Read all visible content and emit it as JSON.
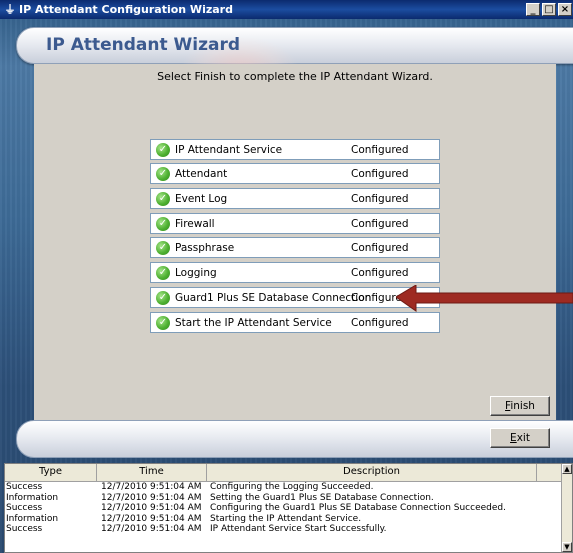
{
  "window": {
    "title": "IP Attendant Configuration Wizard",
    "minimize": "_",
    "maximize": "□",
    "close": "×"
  },
  "header": {
    "title": "IP Attendant Wizard"
  },
  "instruction": "Select Finish to complete the IP Attendant Wizard.",
  "steps": [
    {
      "name": "IP Attendant Service",
      "status": "Configured"
    },
    {
      "name": "Attendant",
      "status": "Configured"
    },
    {
      "name": "Event Log",
      "status": "Configured"
    },
    {
      "name": "Firewall",
      "status": "Configured"
    },
    {
      "name": "Passphrase",
      "status": "Configured"
    },
    {
      "name": "Logging",
      "status": "Configured"
    },
    {
      "name": "Guard1 Plus SE Database Connection",
      "status": "Configured"
    },
    {
      "name": "Start the IP Attendant Service",
      "status": "Configured"
    }
  ],
  "buttons": {
    "finish_first": "F",
    "finish_rest": "inish",
    "exit_first": "E",
    "exit_rest": "xit"
  },
  "log": {
    "columns": [
      "Type",
      "Time",
      "Description"
    ],
    "rows": [
      {
        "type": "Success",
        "time": "12/7/2010 9:51:04 AM",
        "description": "Configuring the Logging Succeeded."
      },
      {
        "type": "Information",
        "time": "12/7/2010 9:51:04 AM",
        "description": "Setting the Guard1 Plus SE Database Connection."
      },
      {
        "type": "Success",
        "time": "12/7/2010 9:51:04 AM",
        "description": "Configuring the Guard1 Plus SE Database Connection Succeeded."
      },
      {
        "type": "Information",
        "time": "12/7/2010 9:51:04 AM",
        "description": "Starting the IP Attendant Service."
      },
      {
        "type": "Success",
        "time": "12/7/2010 9:51:04 AM",
        "description": "IP Attendant Service Start Successfully."
      }
    ]
  },
  "colors": {
    "accent_arrow": "#9e2a22",
    "check_green": "#4fb132",
    "header_text": "#3c5a8f"
  }
}
